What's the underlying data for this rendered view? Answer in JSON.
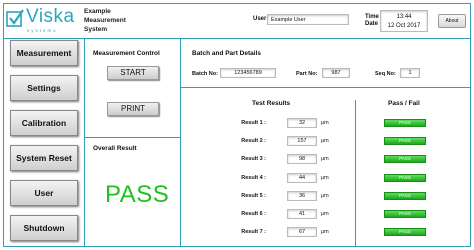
{
  "brand": {
    "name": "Viska",
    "tagline": "systems",
    "color": "#2aa6bf"
  },
  "app_title": [
    "Example",
    "Measurement",
    "System"
  ],
  "header": {
    "user_label": "User",
    "user_value": "Example User",
    "time_label": "Time",
    "date_label": "Date",
    "time_value": "13:44",
    "date_value": "12 Oct 2017",
    "about_label": "About"
  },
  "sidebar": {
    "items": [
      {
        "label": "Measurement"
      },
      {
        "label": "Settings"
      },
      {
        "label": "Calibration"
      },
      {
        "label": "System Reset"
      },
      {
        "label": "User"
      },
      {
        "label": "Shutdown"
      }
    ]
  },
  "measurement_control": {
    "title": "Measurement Control",
    "start_label": "START",
    "print_label": "PRINT"
  },
  "overall": {
    "title": "Overall Result",
    "value": "PASS",
    "color": "#22c020"
  },
  "batch": {
    "title": "Batch and Part Details",
    "batch_label": "Batch No:",
    "batch_value": "123456789",
    "part_label": "Part No:",
    "part_value": "987",
    "seq_label": "Seq No:",
    "seq_value": "1"
  },
  "results": {
    "title": "Test Results",
    "pf_title": "Pass / Fail",
    "unit": "μm",
    "rows": [
      {
        "label": "Result 1 :",
        "value": "32",
        "status": "PASS"
      },
      {
        "label": "Result 2 :",
        "value": "157",
        "status": "PASS"
      },
      {
        "label": "Result 3 :",
        "value": "98",
        "status": "PASS"
      },
      {
        "label": "Result 4 :",
        "value": "44",
        "status": "PASS"
      },
      {
        "label": "Result 5 :",
        "value": "36",
        "status": "PASS"
      },
      {
        "label": "Result 6 :",
        "value": "41",
        "status": "PASS"
      },
      {
        "label": "Result 7 :",
        "value": "67",
        "status": "PASS"
      }
    ]
  },
  "colors": {
    "accent": "#2f9fb5",
    "pass": "#22c020"
  }
}
